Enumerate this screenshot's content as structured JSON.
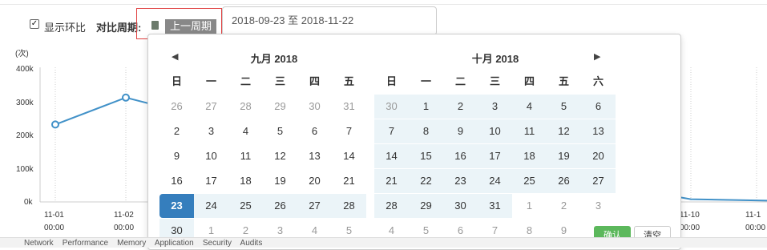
{
  "controls": {
    "checkbox_mark": "✓",
    "compare_label": "显示环比",
    "period_label": "对比周期:",
    "period_button": "上一周期",
    "range_value": "2018-09-23 至 2018-11-22"
  },
  "chart_data": {
    "type": "line",
    "ylabel": "(次)",
    "yticks": [
      "400k",
      "300k",
      "200k",
      "100k",
      "0k"
    ],
    "ylim": [
      0,
      400000
    ],
    "x": [
      "11-01 00:00",
      "11-02 00:00",
      "11-10 00:00",
      "11-1 00:00"
    ],
    "series": [
      {
        "color": "#4191c8",
        "values": [
          230000,
          310000,
          290000,
          8000,
          4000
        ]
      }
    ],
    "grid": "vertical dotted"
  },
  "calendar": {
    "prev_icon": "arrow-left",
    "next_icon": "arrow-right",
    "left_title": "九月 2018",
    "right_title": "十月 2018",
    "weekdays": [
      "日",
      "一",
      "二",
      "三",
      "四",
      "五",
      "六"
    ],
    "left_rows": [
      [
        "26",
        "27",
        "28",
        "29",
        "30",
        "31"
      ],
      [
        "2",
        "3",
        "4",
        "5",
        "6",
        "7"
      ],
      [
        "9",
        "10",
        "11",
        "12",
        "13",
        "14"
      ],
      [
        "16",
        "17",
        "18",
        "19",
        "20",
        "21"
      ],
      [
        "23",
        "24",
        "25",
        "26",
        "27",
        "28"
      ],
      [
        "30",
        "1",
        "2",
        "3",
        "4",
        "5"
      ]
    ],
    "right_rows": [
      [
        "30",
        "1",
        "2",
        "3",
        "4",
        "5",
        "6"
      ],
      [
        "7",
        "8",
        "9",
        "10",
        "11",
        "12",
        "13"
      ],
      [
        "14",
        "15",
        "16",
        "17",
        "18",
        "19",
        "20"
      ],
      [
        "21",
        "22",
        "23",
        "24",
        "25",
        "26",
        "27"
      ],
      [
        "28",
        "29",
        "30",
        "31",
        "1",
        "2",
        "3"
      ],
      [
        "4",
        "5",
        "6",
        "7",
        "8",
        "9",
        ""
      ]
    ],
    "ok_label": "确认",
    "clear_label": "清空"
  },
  "bottom_text": "Network    Performance    Memory    Application    Security    Audits"
}
